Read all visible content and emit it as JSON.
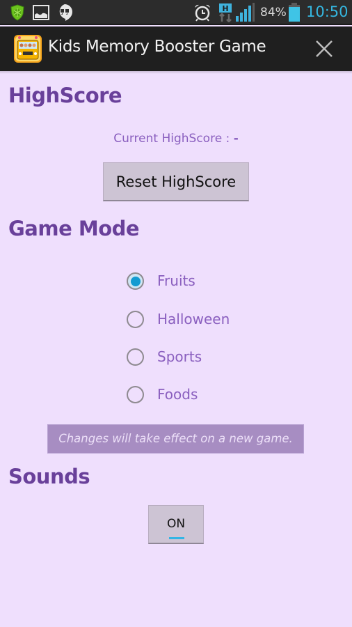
{
  "status_bar": {
    "left_icons": [
      "security-shield-icon",
      "gallery-image-icon",
      "hangouts-icon"
    ],
    "right_icons": [
      "alarm-clock-icon",
      "hspa-data-icon",
      "signal-strength-icon",
      "battery-icon"
    ],
    "battery_percent": "84%",
    "time": "10:50"
  },
  "action_bar": {
    "title": "Kids Memory Booster Game",
    "close_icon": "close-icon"
  },
  "highscore": {
    "title": "HighScore",
    "current_label": "Current HighScore : ",
    "current_value": "-",
    "reset_button": "Reset HighScore"
  },
  "game_mode": {
    "title": "Game Mode",
    "options": [
      {
        "label": "Fruits",
        "checked": true
      },
      {
        "label": "Halloween",
        "checked": false
      },
      {
        "label": "Sports",
        "checked": false
      },
      {
        "label": "Foods",
        "checked": false
      }
    ],
    "notice": "Changes will take effect on a new game."
  },
  "sounds": {
    "title": "Sounds",
    "toggle_label": "ON",
    "toggle_state": true
  },
  "colors": {
    "background": "#efdffd",
    "heading": "#69409a",
    "text": "#8a5fbf",
    "accent": "#33b5e5",
    "radio_checked": "#139bd1"
  }
}
